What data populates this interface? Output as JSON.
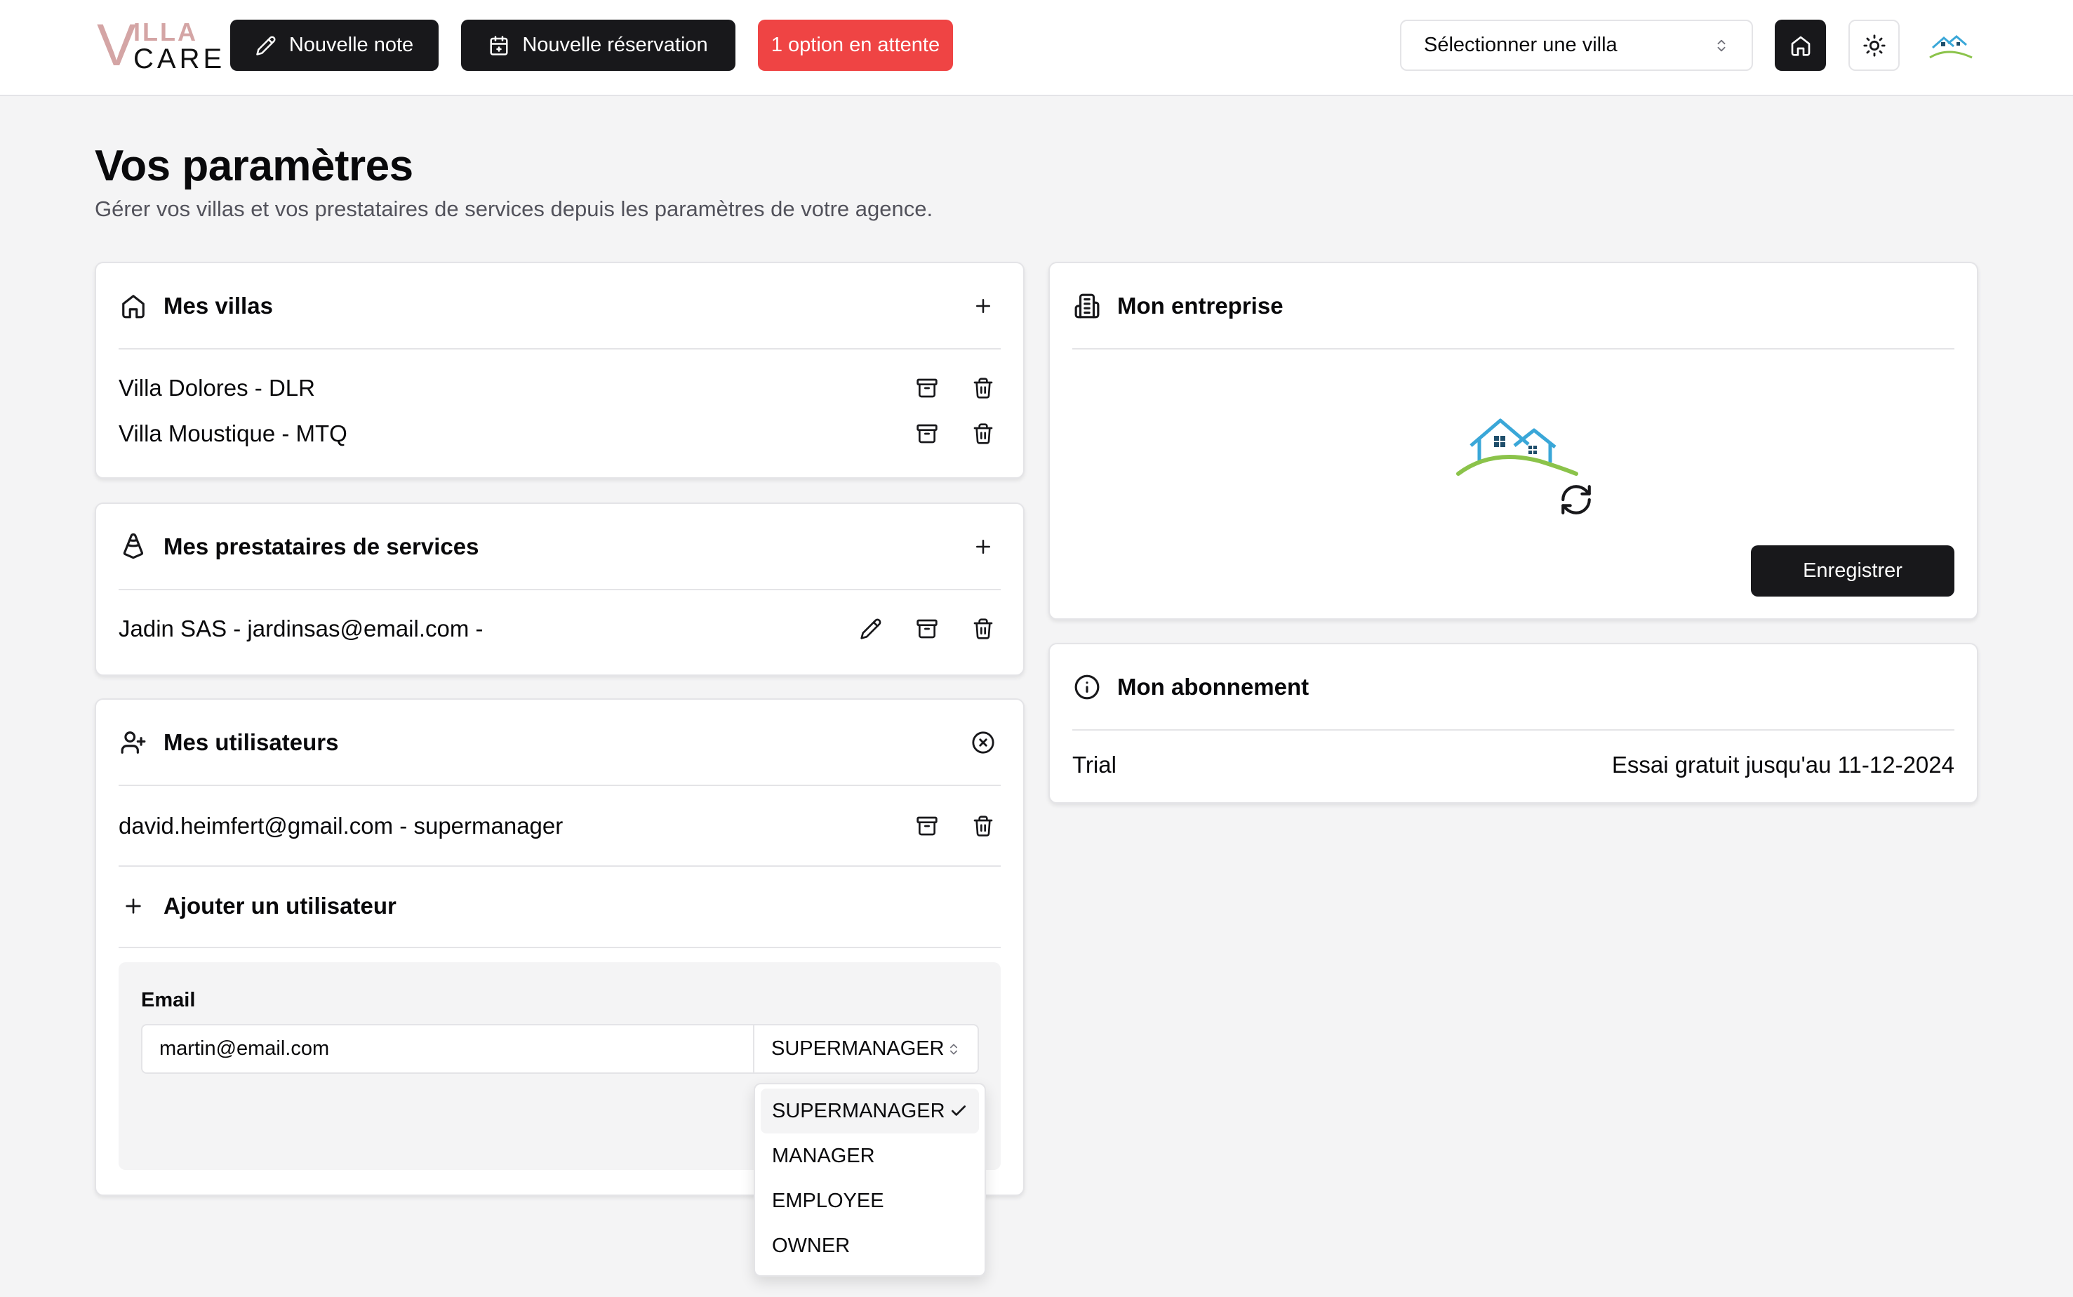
{
  "brand": {
    "logo_v": "V",
    "logo_top": "ILLA",
    "logo_bottom": "CARE",
    "accent_color": "#d4a5a5"
  },
  "header": {
    "new_note": "Nouvelle note",
    "new_booking": "Nouvelle réservation",
    "pending_badge": "1 option en attente",
    "villa_select": "Sélectionner une villa",
    "icons": [
      "pencil-icon",
      "calendar-plus-icon",
      "chevrons-up-down-icon",
      "home-icon",
      "sun-icon"
    ]
  },
  "page": {
    "title": "Vos paramètres",
    "subtitle": "Gérer vos villas et vos prestataires de services depuis les paramètres de votre agence."
  },
  "villas": {
    "title": "Mes villas",
    "items": [
      {
        "label": "Villa Dolores - DLR"
      },
      {
        "label": "Villa Moustique - MTQ"
      }
    ]
  },
  "providers": {
    "title": "Mes prestataires de services",
    "items": [
      {
        "label": "Jadin SAS - jardinsas@email.com -"
      }
    ]
  },
  "users": {
    "title": "Mes utilisateurs",
    "items": [
      {
        "label": "david.heimfert@gmail.com - supermanager"
      }
    ],
    "add_label": "Ajouter un utilisateur",
    "form": {
      "email_label": "Email",
      "email_value": "martin@email.com",
      "role_value": "SUPERMANAGER",
      "role_options": [
        "SUPERMANAGER",
        "MANAGER",
        "EMPLOYEE",
        "OWNER"
      ],
      "role_selected": "SUPERMANAGER"
    }
  },
  "company": {
    "title": "Mon entreprise",
    "save_label": "Enregistrer"
  },
  "subscription": {
    "title": "Mon abonnement",
    "plan": "Trial",
    "detail": "Essai gratuit jusqu'au 11-12-2024"
  },
  "colors": {
    "dark": "#18181b",
    "danger": "#ef4444",
    "border": "#e4e4e7",
    "muted_bg": "#f4f4f5"
  }
}
